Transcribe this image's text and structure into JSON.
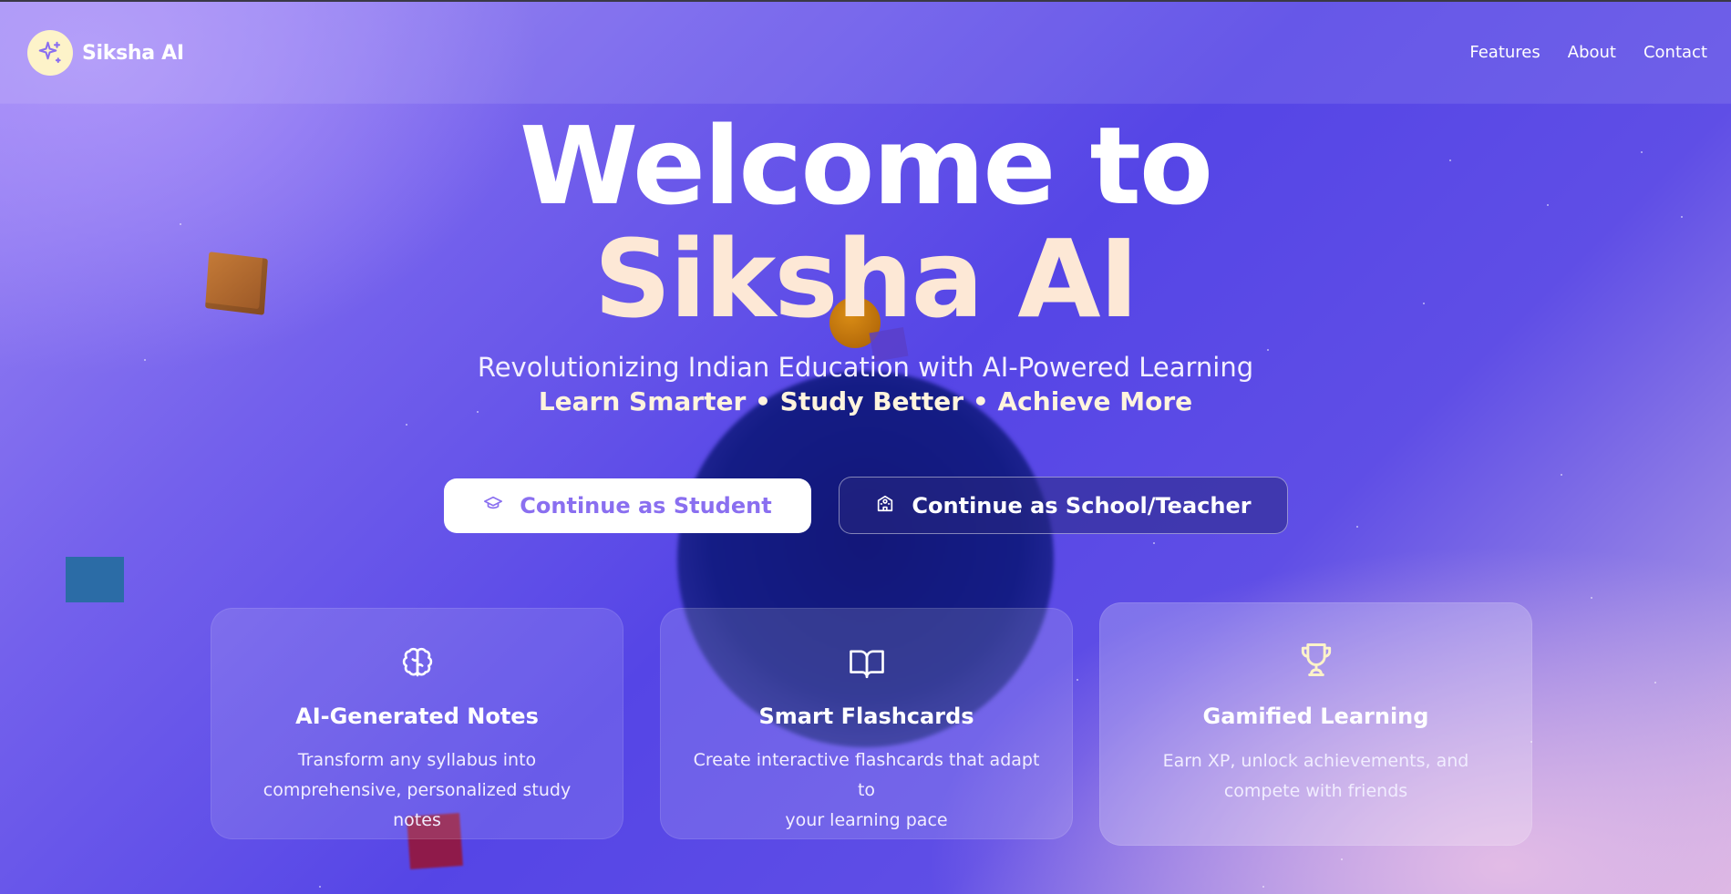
{
  "app": {
    "brand": "Siksha AI"
  },
  "nav": {
    "links": [
      "Features",
      "About",
      "Contact"
    ]
  },
  "hero": {
    "title_line1": "Welcome to",
    "title_line2": "Siksha AI",
    "subtitle": "Revolutionizing Indian Education with AI-Powered Learning",
    "tagline": "Learn Smarter • Study Better • Achieve More"
  },
  "actions": {
    "student": "Continue as Student",
    "teacher": "Continue as School/Teacher"
  },
  "features": [
    {
      "icon": "brain-icon",
      "title": "AI-Generated Notes",
      "desc_line1": "Transform any syllabus into",
      "desc_line2": "comprehensive, personalized study notes"
    },
    {
      "icon": "book-open-icon",
      "title": "Smart Flashcards",
      "desc_line1": "Create interactive flashcards that adapt to",
      "desc_line2": "your learning pace"
    },
    {
      "icon": "trophy-icon",
      "title": "Gamified Learning",
      "desc_line1": "Earn XP, unlock achievements, and",
      "desc_line2": "compete with friends"
    }
  ],
  "colors": {
    "accent": "#8a6ff0",
    "background_start": "#9b86f4",
    "background_mid": "#5545e6",
    "background_end": "#d3b0e2",
    "title_highlight": "#fde8d6",
    "logo_badge": "#fdf3c9"
  }
}
